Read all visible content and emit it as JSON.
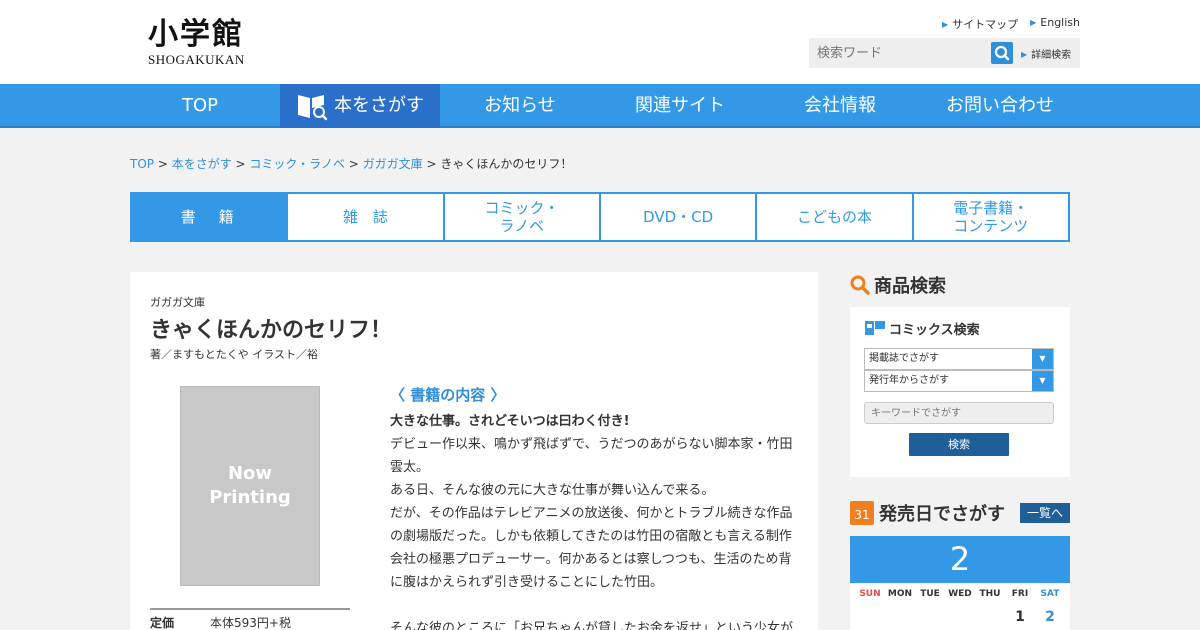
{
  "header": {
    "logo_kanji": "小学館",
    "logo_roman": "SHOGAKUKAN",
    "links": [
      "サイトマップ",
      "English"
    ],
    "search_placeholder": "検索ワード",
    "detail_search": "詳細検索"
  },
  "nav": {
    "items": [
      "TOP",
      "本をさがす",
      "お知らせ",
      "関連サイト",
      "会社情報",
      "お問い合わせ"
    ],
    "active": "本をさがす"
  },
  "breadcrumb": [
    "TOP",
    "本をさがす",
    "コミック・ラノベ",
    "ガガガ文庫",
    "きゃくほんかのセリフ！"
  ],
  "category_tabs": [
    "書　籍",
    "雑　誌",
    "コミック・\nラノベ",
    "DVD・CD",
    "こどもの本",
    "電子書籍・\nコンテンツ"
  ],
  "book": {
    "series": "ガガガ文庫",
    "title": "きゃくほんかのセリフ！",
    "credits": "著／ますもとたくや イラスト／裕",
    "cover_text": "Now\nPrinting",
    "price_label": "定価",
    "price_value": "本体593円+税",
    "content_heading": "〈 書籍の内容 〉",
    "content_lead": "大きな仕事。されどそいつは曰わく付き!",
    "content_paragraphs": [
      "デビュー作以来、鳴かず飛ばずで、うだつのあがらない脚本家・竹田雲太。",
      "ある日、そんな彼の元に大きな仕事が舞い込んで来る。",
      "だが、その作品はテレビアニメの放送後、何かとトラブル続きな作品の劇場版だった。しかも依頼してきたのは竹田の宿敵とも言える制作会社の極悪プロデューサー。何かあるとは察しつつも、生活のため背に腹はかえられず引き受けることにした竹田。",
      "",
      "そんな彼のところに「お兄ちゃんが貸したお金を返せ」という少女が"
    ]
  },
  "sidebar": {
    "product_search": "商品検索",
    "comics_search": "コミックス検索",
    "select_magazine": "掲載誌でさがす",
    "select_year": "発行年からさがす",
    "keyword_placeholder": "キーワードでさがす",
    "search_button": "検索",
    "release_heading": "発売日でさがす",
    "calendar_icon_num": "31",
    "list_button": "一覧へ",
    "month": "2",
    "weekdays": [
      "SUN",
      "MON",
      "TUE",
      "WED",
      "THU",
      "FRI",
      "SAT"
    ],
    "first_week": [
      "",
      "",
      "",
      "",
      "",
      "1",
      "2"
    ]
  }
}
